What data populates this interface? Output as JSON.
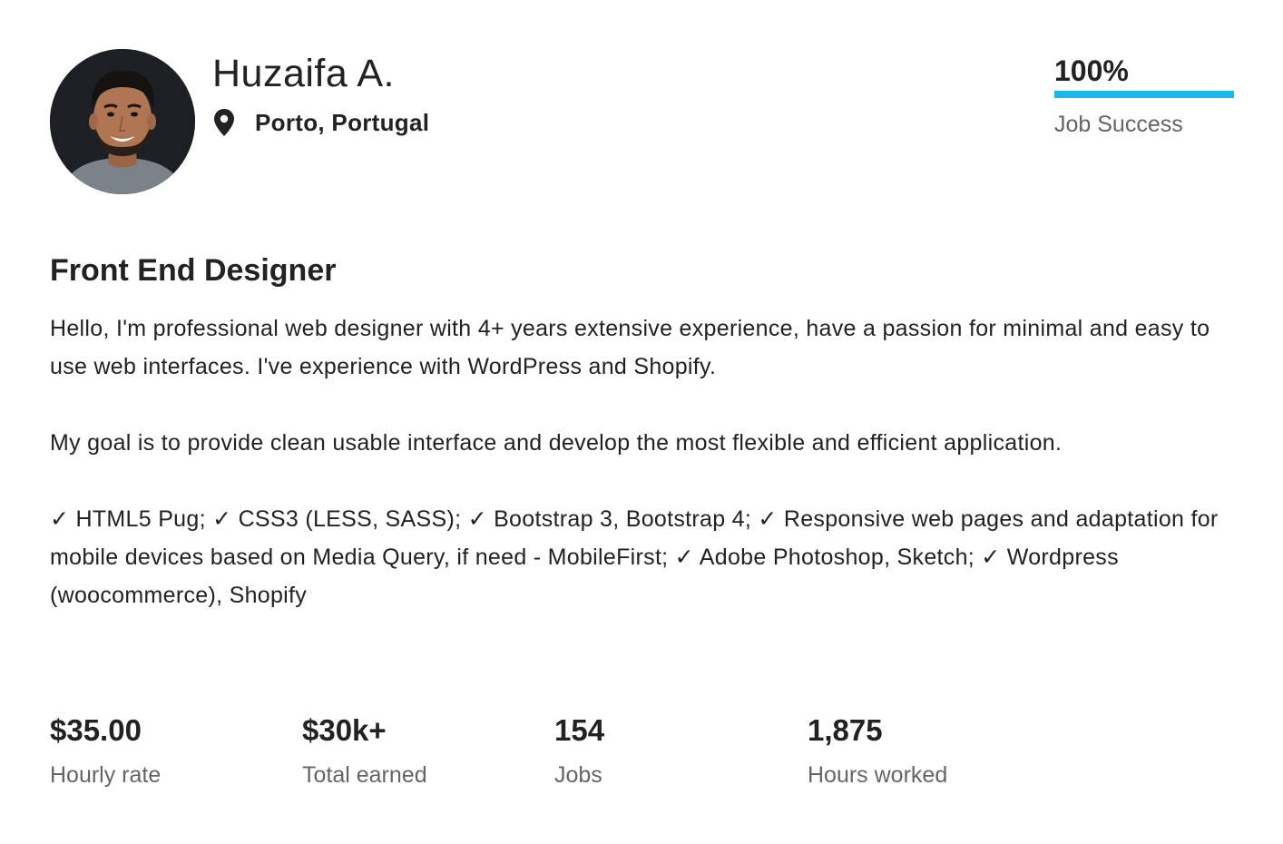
{
  "profile": {
    "name": "Huzaifa A.",
    "location": "Porto, Portugal",
    "title": "Front End Designer"
  },
  "job_success": {
    "value_text": "100%",
    "label": "Job Success",
    "fraction": 1.0,
    "bar_color": "#1bb6ea"
  },
  "description": {
    "paragraphs": [
      "Hello, I'm professional web designer with 4+ years extensive experience, have a passion for minimal and easy to use web interfaces. I've experience with WordPress and Shopify.",
      "My goal is to provide clean usable interface and develop the most flexible and efficient application.",
      "✓ HTML5 Pug; ✓ CSS3 (LESS, SASS); ✓ Bootstrap 3, Bootstrap 4; ✓ Responsive web pages and adaptation for mobile devices based on Media Query, if need - MobileFirst; ✓ Adobe Photoshop, Sketch; ✓ Wordpress (woocommerce), Shopify"
    ]
  },
  "stats": [
    {
      "value": "$35.00",
      "label": "Hourly rate"
    },
    {
      "value": "$30k+",
      "label": "Total earned"
    },
    {
      "value": "154",
      "label": "Jobs"
    },
    {
      "value": "1,875",
      "label": "Hours worked"
    }
  ],
  "icons": {
    "location": "map-pin-icon"
  }
}
